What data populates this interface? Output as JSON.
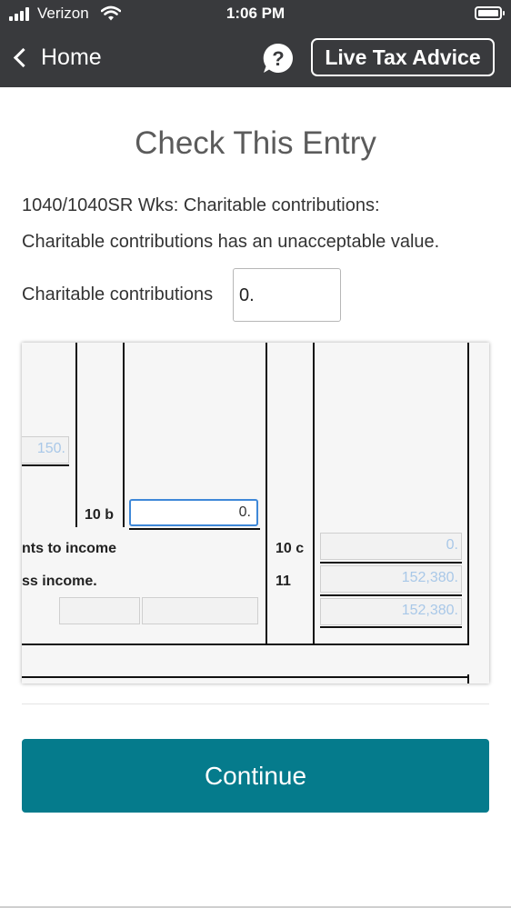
{
  "status_bar": {
    "carrier": "Verizon",
    "time": "1:06 PM"
  },
  "nav": {
    "back_label": "Home",
    "help_icon": "question-bubble-icon",
    "advice_label": "Live Tax Advice"
  },
  "dialog": {
    "title": "Check This Entry",
    "source": "1040/1040SR Wks: Charitable contributions:",
    "message": "Charitable contributions has an unacceptable value.",
    "field_label": "Charitable contributions",
    "field_value": "0."
  },
  "form": {
    "value_150": "150.",
    "line_10b_label": "10 b",
    "line_10b_value": "0.",
    "row_10c_text": "nts to income",
    "line_10c_label": "10 c",
    "line_10c_value": "0.",
    "row_11_text": "ss income.",
    "line_11_label": "11",
    "line_11_value": "152,380.",
    "line_12_value": "152,380."
  },
  "actions": {
    "continue_label": "Continue"
  },
  "colors": {
    "header": "#393a3d",
    "continue": "#057b8c",
    "active_field": "#3f88d8",
    "computed_text": "#a9c8e8"
  }
}
